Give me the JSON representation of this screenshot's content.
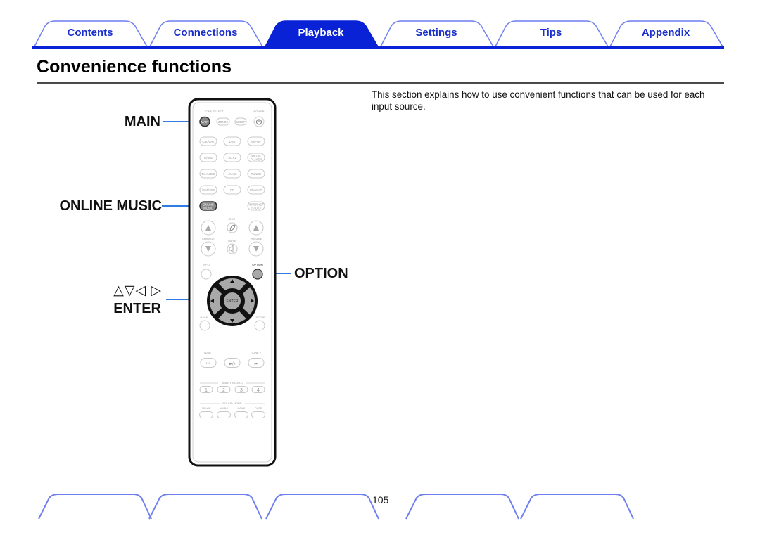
{
  "nav": {
    "tabs": [
      {
        "label": "Contents",
        "active": false
      },
      {
        "label": "Connections",
        "active": false
      },
      {
        "label": "Playback",
        "active": true
      },
      {
        "label": "Settings",
        "active": false
      },
      {
        "label": "Tips",
        "active": false
      },
      {
        "label": "Appendix",
        "active": false
      }
    ],
    "colors": {
      "tab_border": "#6e7ff0",
      "accent": "#0a22d6",
      "tab_text": "#1a2ecc"
    }
  },
  "page": {
    "title": "Convenience functions",
    "intro": "This section explains how to use convenient functions that can be used for each input source.",
    "page_number": "105"
  },
  "callouts": {
    "main": "MAIN",
    "online_music": "ONLINE MUSIC",
    "option": "OPTION",
    "arrows": "△▽◁ ▷",
    "enter": "ENTER",
    "line_color": "#2f7de0"
  },
  "remote": {
    "zone_select_label": "ZONE SELECT",
    "power_label": "POWER",
    "zone_buttons": [
      "MAIN",
      "ZONE2",
      "SLEEP"
    ],
    "power_icon": "power-icon",
    "source_rows": [
      [
        "CBL/SAT",
        "DVD",
        "Blu-ray"
      ],
      [
        "GAME",
        "AUX1",
        "MEDIA PLAYER"
      ],
      [
        "TV AUDIO",
        "AUX2",
        "TUNER"
      ],
      [
        "iPod/USB",
        "CD",
        "Bluetooth"
      ],
      [
        "ONLINE MUSIC",
        "",
        "INTERNET RADIO"
      ]
    ],
    "eco_label": "ECO",
    "ch_page_label": "CH/PAGE",
    "mute_label": "MUTE",
    "volume_label": "VOLUME",
    "info_label": "INFO",
    "option_label": "OPTION",
    "enter_label": "ENTER",
    "back_label": "BACK",
    "setup_label": "SETUP",
    "tune_minus_label": "TUNE -",
    "tune_plus_label": "TUNE +",
    "transport": [
      "⏮",
      "▶/⏸",
      "⏭"
    ],
    "smart_select_label": "SMART SELECT",
    "smart_select_buttons": [
      "1",
      "2",
      "3",
      "4"
    ],
    "sound_mode_label": "SOUND MODE",
    "sound_mode_buttons": [
      "MOVIE",
      "MUSIC",
      "GAME",
      "PURE"
    ]
  }
}
